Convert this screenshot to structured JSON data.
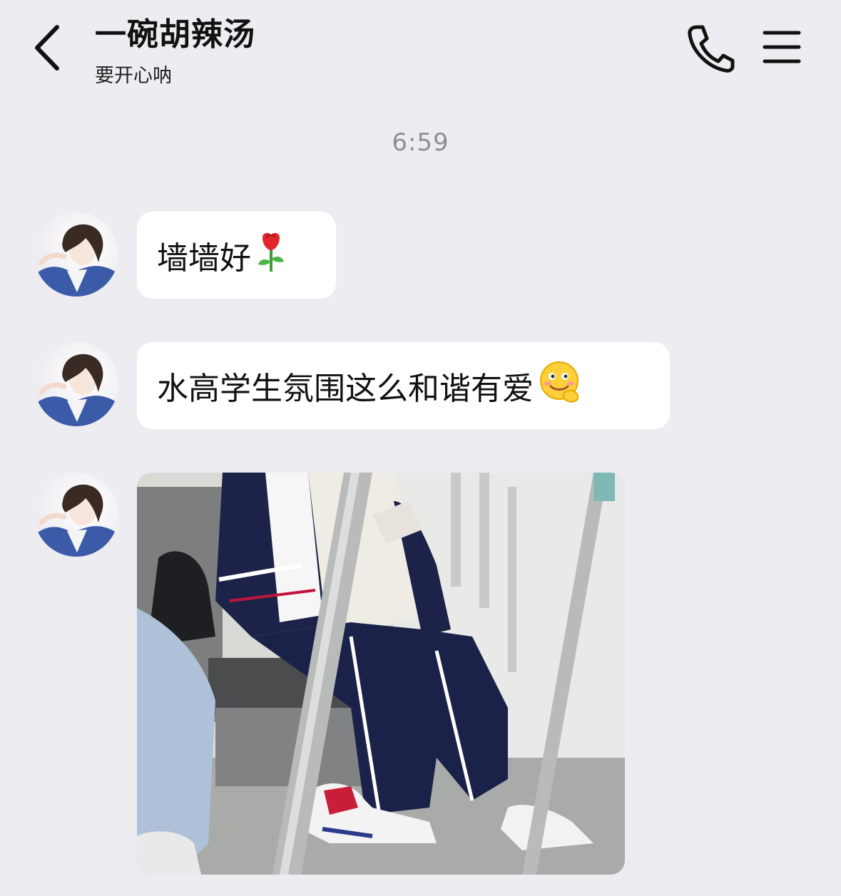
{
  "header": {
    "title": "一碗胡辣汤",
    "subtitle": "要开心呐"
  },
  "chat": {
    "timestamp": "6:59",
    "messages": [
      {
        "text": "墙墙好",
        "emoji": "rose-emoji"
      },
      {
        "text": "水高学生氛围这么和谐有爱",
        "emoji": "smiling-face-emoji"
      },
      {
        "type": "image",
        "description_icon": "photo-icon"
      }
    ]
  },
  "colors": {
    "background": "#ededf1",
    "bubble": "#ffffff",
    "timestamp": "#8e8e93"
  }
}
